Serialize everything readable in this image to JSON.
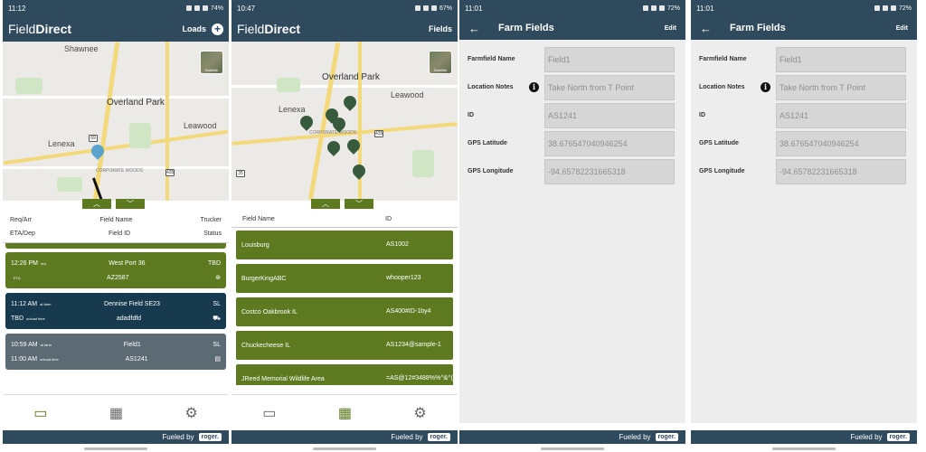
{
  "phone1": {
    "status": {
      "time": "11:12",
      "battery": "74%"
    },
    "brand_prefix": "Field",
    "brand_suffix": "Direct",
    "action_label": "Loads",
    "map_labels": [
      "Shawnee",
      "Overland Park",
      "Leawood",
      "Lenexa",
      "CORPORATE WOODS"
    ],
    "map_shields": [
      "69",
      "435"
    ],
    "list_header": {
      "r1": [
        "Req/Arr",
        "Field Name",
        "Trucker"
      ],
      "r2": [
        "ETA/Dep",
        "Field ID",
        "Status"
      ]
    },
    "loads": [
      {
        "t1": "12:26 PM",
        "s1": "req",
        "name": "West Port 36",
        "right1": "TBD",
        "t2": "",
        "s2": "ETA",
        "id": "AZ2587",
        "icon": "steering-wheel-icon",
        "color": "#5d7a21"
      },
      {
        "t1": "11:12 AM",
        "s1": "at farm",
        "name": "Dennise Field SE23",
        "right1": "SL",
        "t2": "TBD",
        "s2": "unload time",
        "id": "adadfdfd",
        "icon": "truck-icon",
        "color": "#173a4f"
      },
      {
        "t1": "10:59 AM",
        "s1": "at farm",
        "name": "Field1",
        "right1": "SL",
        "t2": "11:00 AM",
        "s2": "unload time",
        "id": "AS1241",
        "icon": "document-icon",
        "color": "#5b6a73"
      }
    ],
    "footer": {
      "text": "Fueled by",
      "logo": "roger."
    }
  },
  "phone2": {
    "status": {
      "time": "10:47",
      "battery": "67%"
    },
    "brand_prefix": "Field",
    "brand_suffix": "Direct",
    "action_label": "Fields",
    "map_labels": [
      "Overland Park",
      "Lenexa",
      "Leawood",
      "CORPORATE WOODS"
    ],
    "map_shields": [
      "435",
      "35"
    ],
    "header": {
      "name": "Field Name",
      "id": "ID"
    },
    "fields": [
      {
        "name": "Louisburg",
        "id": "AS1002"
      },
      {
        "name": "BurgerKingABC",
        "id": "whooper123"
      },
      {
        "name": "Costco Oakbrook IL",
        "id": "AS400#ID-1by4"
      },
      {
        "name": "Chuckecheese IL",
        "id": "AS1234@sample-1"
      },
      {
        "name": "JReed Memorial Wildlife Area",
        "id": "=AS@12#3488%%^&^()!="
      }
    ],
    "footer": {
      "text": "Fueled by",
      "logo": "roger."
    }
  },
  "phone3": {
    "status": {
      "time": "11:01",
      "battery": "72%"
    },
    "title": "Farm Fields",
    "edit": "Edit",
    "form": [
      {
        "label": "Farmfield Name",
        "value": "Field1"
      },
      {
        "label": "Location Notes",
        "value": "Take North from T Point"
      },
      {
        "label": "ID",
        "value": "AS1241"
      },
      {
        "label": "GPS Latitude",
        "value": "38.676547040946254"
      },
      {
        "label": "GPS Longitude",
        "value": "-94.65782231665318"
      }
    ],
    "footer": {
      "text": "Fueled by",
      "logo": "roger."
    }
  },
  "phone4": {
    "status": {
      "time": "11:01",
      "battery": "72%"
    },
    "title": "Farm Fields",
    "edit": "Edit",
    "form": [
      {
        "label": "Farmfield Name",
        "value": "Field1"
      },
      {
        "label": "Location Notes",
        "value": "Take North from T Point"
      },
      {
        "label": "ID",
        "value": "AS1241"
      },
      {
        "label": "GPS Latitude",
        "value": "38.676547040946254"
      },
      {
        "label": "GPS Longitude",
        "value": "-94.65782231665318"
      }
    ],
    "footer": {
      "text": "Fueled by",
      "logo": "roger."
    }
  },
  "satellite_label": "Satellite",
  "colors": {
    "header": "#2f4a5c",
    "green": "#5d7a21",
    "navy": "#173a4f",
    "gray": "#5b6a73"
  }
}
